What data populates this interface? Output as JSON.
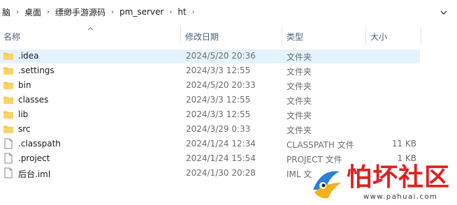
{
  "breadcrumb": [
    "脑",
    "桌面",
    "缥缈手游源码",
    "pm_server",
    "ht"
  ],
  "columns": {
    "name": "名称",
    "date": "修改日期",
    "type": "类型",
    "size": "大小"
  },
  "files": [
    {
      "name": ".idea",
      "date": "2024/5/20 20:36",
      "type": "文件夹",
      "size": "",
      "icon": "folder-icon",
      "selected": true
    },
    {
      "name": ".settings",
      "date": "2024/3/3 12:55",
      "type": "文件夹",
      "size": "",
      "icon": "folder-icon"
    },
    {
      "name": "bin",
      "date": "2024/5/20 20:33",
      "type": "文件夹",
      "size": "",
      "icon": "folder-icon"
    },
    {
      "name": "classes",
      "date": "2024/3/3 12:55",
      "type": "文件夹",
      "size": "",
      "icon": "folder-icon"
    },
    {
      "name": "lib",
      "date": "2024/3/3 12:55",
      "type": "文件夹",
      "size": "",
      "icon": "folder-icon"
    },
    {
      "name": "src",
      "date": "2024/3/29 0:33",
      "type": "文件夹",
      "size": "",
      "icon": "folder-icon"
    },
    {
      "name": ".classpath",
      "date": "2024/1/24 12:34",
      "type": "CLASSPATH 文件",
      "size": "11 KB",
      "icon": "file-icon"
    },
    {
      "name": ".project",
      "date": "2024/1/24 15:54",
      "type": "PROJECT 文件",
      "size": "1 KB",
      "icon": "file-icon"
    },
    {
      "name": "后台.iml",
      "date": "2024/1/30 20:28",
      "type": "IML 文",
      "size": "",
      "icon": "file-icon"
    }
  ],
  "watermark": {
    "text": "怕坏社区",
    "url": "www.pahuai.com"
  },
  "colors": {
    "folder": "#f8c74a",
    "selection": "#e5f3ff",
    "header_text": "#4c607a",
    "watermark": "#e02020"
  }
}
